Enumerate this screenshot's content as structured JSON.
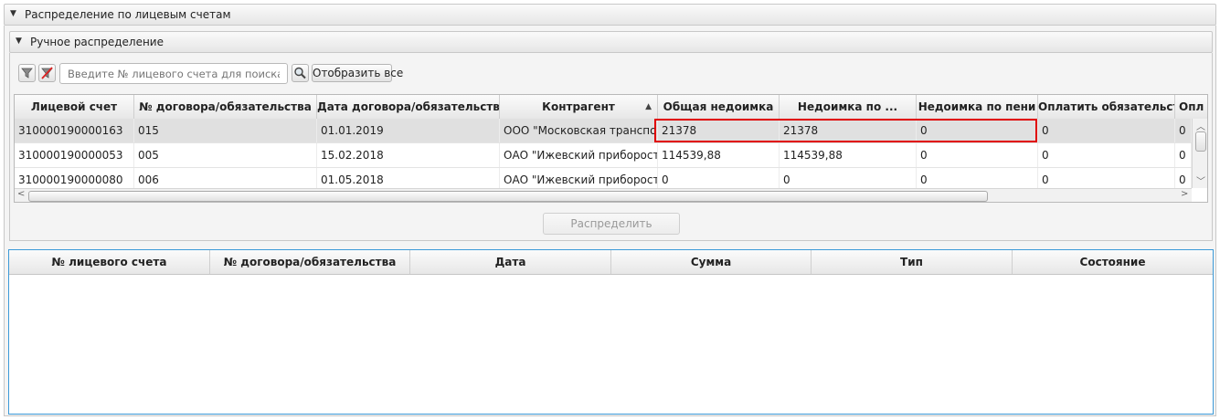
{
  "outer_panel": {
    "title": "Распределение по лицевым счетам"
  },
  "inner_panel": {
    "title": "Ручное распределение"
  },
  "toolbar": {
    "filter_icon": "funnel-icon",
    "clear_filter_icon": "funnel-clear-icon",
    "search_placeholder": "Введите № лицевого счета для поиска",
    "search_value": "",
    "search_icon": "magnifier-icon",
    "show_all_label": "Отобразить все"
  },
  "accounts_table": {
    "columns": [
      "Лицевой счет",
      "№ договора/обязательства",
      "Дата договора/обязательства",
      "Контрагент",
      "Общая недоимка",
      "Недоимка по ...",
      "Недоимка по пени",
      "Оплатить обязательств",
      "Опл"
    ],
    "sorted_column": "Контрагент",
    "sort_direction": "ascending",
    "rows": [
      [
        "310000190000163",
        "015",
        "01.01.2019",
        "ООО \"Московская транспор...",
        "21378",
        "21378",
        "0",
        "0",
        "0"
      ],
      [
        "310000190000053",
        "005",
        "15.02.2018",
        "ОАО \"Ижевский приборост...",
        "114539,88",
        "114539,88",
        "0",
        "0",
        "0"
      ],
      [
        "310000190000080",
        "006",
        "01.05.2018",
        "ОАО \"Ижевский приборост...",
        "0",
        "0",
        "0",
        "0",
        "0"
      ]
    ]
  },
  "distribute_button": {
    "label": "Распределить",
    "enabled": false
  },
  "result_table": {
    "columns": [
      "№ лицевого счета",
      "№ договора/обязательства",
      "Дата",
      "Сумма",
      "Тип",
      "Состояние"
    ],
    "rows": []
  },
  "colors": {
    "highlight": "#e00000",
    "result_table_border": "#3c9ad8",
    "selected_row": "#e0e0e0"
  }
}
